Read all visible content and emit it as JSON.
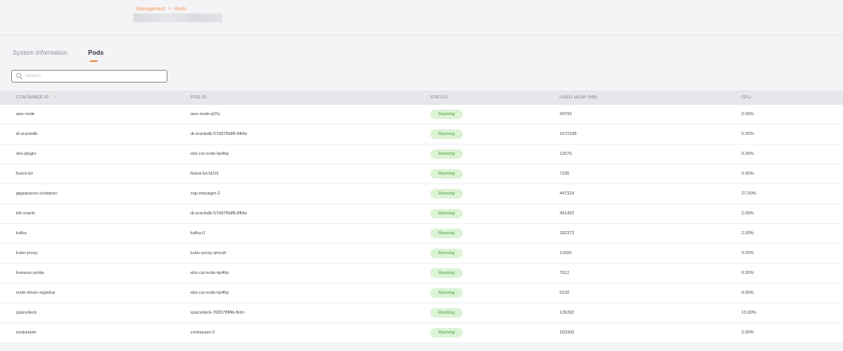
{
  "breadcrumb": {
    "items": [
      "Management",
      "Hosts"
    ],
    "separator": ">"
  },
  "tabs": [
    {
      "label": "System Information",
      "active": false
    },
    {
      "label": "Pods",
      "active": true
    }
  ],
  "search": {
    "placeholder": "Search",
    "value": ""
  },
  "table": {
    "columns": [
      "CONTAINER ID",
      "POD ID",
      "STATUS",
      "USED HEAP (MB)",
      "CPU"
    ],
    "sort_indicator": "↑",
    "rows": [
      {
        "container_id": "aws-node",
        "pod_id": "aws-node-ql7tz",
        "status": "Running",
        "used_heap": "34792",
        "cpu": "2.00%"
      },
      {
        "container_id": "di-oracledb",
        "pod_id": "di-oracledb-57d97f9df8-8fkfw",
        "status": "Running",
        "used_heap": "1672108",
        "cpu": "5.00%"
      },
      {
        "container_id": "ebs-plugin",
        "pod_id": "ebs-csi-node-kp4hp",
        "status": "Running",
        "used_heap": "12576",
        "cpu": "0.00%"
      },
      {
        "container_id": "fluent-bit",
        "pod_id": "fluent-bit-5t2r9",
        "status": "Running",
        "used_heap": "7336",
        "cpu": "0.00%"
      },
      {
        "container_id": "gigaspaces-container",
        "pod_id": "xap-manager-2",
        "status": "Running",
        "used_heap": "447324",
        "cpu": "27.00%"
      },
      {
        "container_id": "iidr-oracle",
        "pod_id": "di-oracledb-57d97f9df8-8fkfw",
        "status": "Running",
        "used_heap": "491452",
        "cpu": "2.00%"
      },
      {
        "container_id": "kafka",
        "pod_id": "kafka-0",
        "status": "Running",
        "used_heap": "392372",
        "cpu": "2.00%"
      },
      {
        "container_id": "kube-proxy",
        "pod_id": "kube-proxy-qmcsh",
        "status": "Running",
        "used_heap": "11600",
        "cpu": "0.00%"
      },
      {
        "container_id": "liveness-probe",
        "pod_id": "ebs-csi-node-kp4hp",
        "status": "Running",
        "used_heap": "7912",
        "cpu": "0.00%"
      },
      {
        "container_id": "node-driver-registrar",
        "pod_id": "ebs-csi-node-kp4hp",
        "status": "Running",
        "used_heap": "5100",
        "cpu": "0.00%"
      },
      {
        "container_id": "spacedeck",
        "pod_id": "spacedeck-766578ff4b-fkbn",
        "status": "Running",
        "used_heap": "136392",
        "cpu": "13.00%"
      },
      {
        "container_id": "zookeeper",
        "pod_id": "zookeeper-0",
        "status": "Running",
        "used_heap": "150300",
        "cpu": "2.00%"
      }
    ]
  },
  "colors": {
    "accent": "#f28b4b",
    "status_running_bg": "#dcf3d6",
    "status_running_text": "#48a33a"
  },
  "icons": {
    "search": "search-icon",
    "sort": "sort-ascending-icon"
  }
}
